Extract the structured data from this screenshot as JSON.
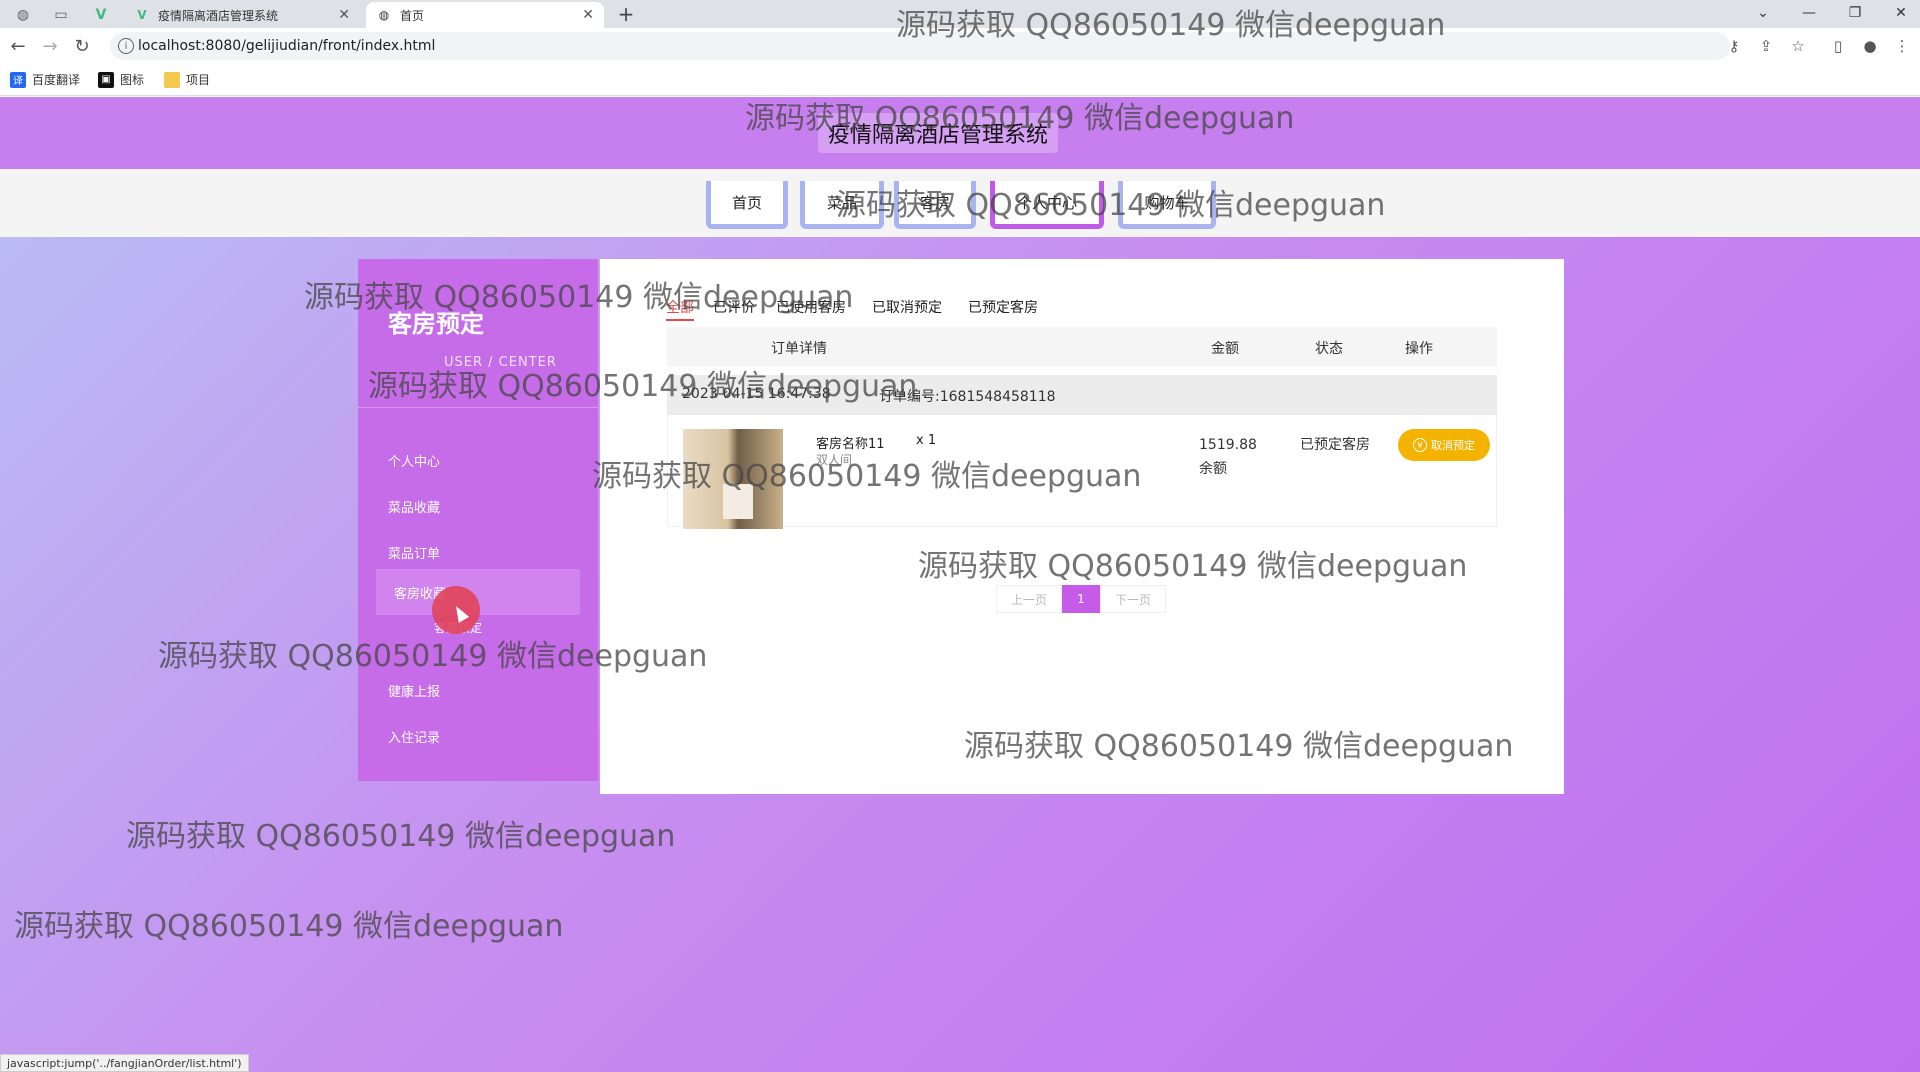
{
  "browser": {
    "tabs": [
      {
        "title": "疫情隔离酒店管理系统",
        "icon": "V",
        "icon_color": "#41b883"
      },
      {
        "title": "首页",
        "icon": "globe"
      }
    ],
    "url": "localhost:8080/gelijiudian/front/index.html",
    "bookmarks": [
      "百度翻译",
      "图标",
      "项目"
    ],
    "status_url": "javascript:jump('../fangjianOrder/list.html')"
  },
  "site": {
    "title": "疫情隔离酒店管理系统",
    "nav": [
      "首页",
      "菜品",
      "客房",
      "个人中心",
      "购物车"
    ],
    "active_nav": "个人中心"
  },
  "sidebar": {
    "title": "客房预定",
    "subtitle": "USER / CENTER",
    "items": [
      "个人中心",
      "菜品收藏",
      "菜品订单",
      "客房收藏",
      "健康上报",
      "入住记录"
    ],
    "active_item": "客房收藏",
    "hover_subitem": "客房预定"
  },
  "orders": {
    "filters": [
      "全部",
      "已评价",
      "已使用客房",
      "已取消预定",
      "已预定客房"
    ],
    "active_filter": "全部",
    "columns": [
      "订单详情",
      "金额",
      "状态",
      "操作"
    ],
    "items": [
      {
        "time": "2023-04-15 16:47:38",
        "order_no": "订单编号:1681548458118",
        "name": "客房名称11",
        "type": "双人间",
        "qty": "x 1",
        "amount": "1519.88",
        "pay_method": "余额",
        "status": "已预定客房",
        "action": "取消预定"
      }
    ],
    "pagination": {
      "prev": "上一页",
      "current": "1",
      "next": "下一页"
    }
  },
  "colors": {
    "accent": "#c55be8",
    "danger": "#e54848",
    "warning": "#f5b301"
  },
  "watermark": "源码获取 QQ86050149 微信deepguan"
}
